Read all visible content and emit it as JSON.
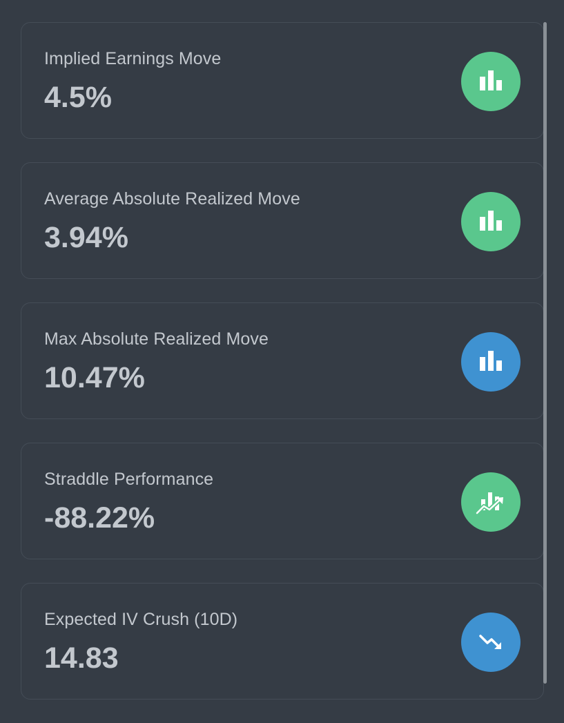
{
  "colors": {
    "background": "#353c45",
    "card_border": "#454d57",
    "text": "#c3c8ce",
    "green": "#5ac78d",
    "blue": "#3f92d1"
  },
  "stats": [
    {
      "label": "Implied Earnings Move",
      "value": "4.5%",
      "icon": "bar-chart-icon",
      "icon_color": "green"
    },
    {
      "label": "Average Absolute Realized Move",
      "value": "3.94%",
      "icon": "bar-chart-icon",
      "icon_color": "green"
    },
    {
      "label": "Max Absolute Realized Move",
      "value": "10.47%",
      "icon": "bar-chart-icon",
      "icon_color": "blue"
    },
    {
      "label": "Straddle Performance",
      "value": "-88.22%",
      "icon": "chart-line-icon",
      "icon_color": "green"
    },
    {
      "label": "Expected IV Crush (10D)",
      "value": "14.83",
      "icon": "trend-down-icon",
      "icon_color": "blue"
    }
  ]
}
